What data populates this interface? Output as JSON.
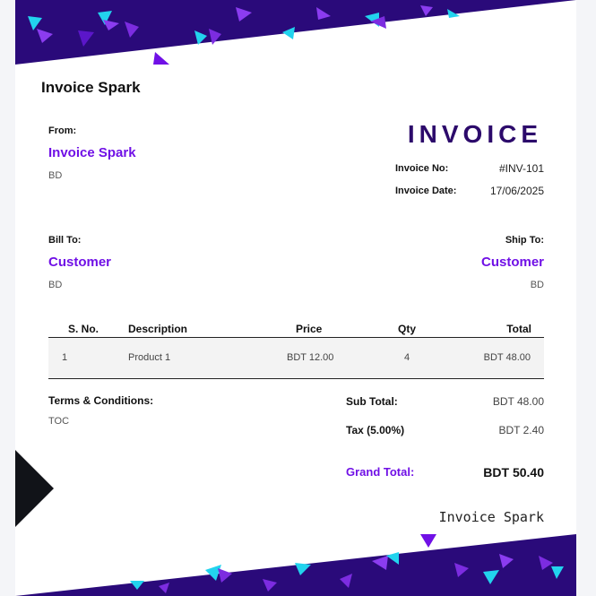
{
  "brand": "Invoice Spark",
  "document_title": "INVOICE",
  "from": {
    "label": "From:",
    "name": "Invoice Spark",
    "country": "BD"
  },
  "invoice_meta": {
    "number_label": "Invoice No:",
    "number": "#INV-101",
    "date_label": "Invoice Date:",
    "date": "17/06/2025"
  },
  "bill_to": {
    "label": "Bill To:",
    "name": "Customer",
    "country": "BD"
  },
  "ship_to": {
    "label": "Ship To:",
    "name": "Customer",
    "country": "BD"
  },
  "table": {
    "headers": {
      "sno": "S. No.",
      "description": "Description",
      "price": "Price",
      "qty": "Qty",
      "total": "Total"
    },
    "rows": [
      {
        "sno": "1",
        "description": "Product 1",
        "price": "BDT 12.00",
        "qty": "4",
        "total": "BDT 48.00"
      }
    ]
  },
  "terms": {
    "label": "Terms & Conditions:",
    "text": "TOC"
  },
  "summary": {
    "subtotal_label": "Sub Total:",
    "subtotal": "BDT 48.00",
    "tax_label": "Tax (5.00%)",
    "tax": "BDT 2.40",
    "grand_label": "Grand Total:",
    "grand": "BDT 50.40"
  },
  "signature": "Invoice Spark",
  "colors": {
    "accent": "#7010e6",
    "title": "#2c0a6b",
    "band": "#2a0a7a",
    "cyan": "#22d3ee"
  }
}
